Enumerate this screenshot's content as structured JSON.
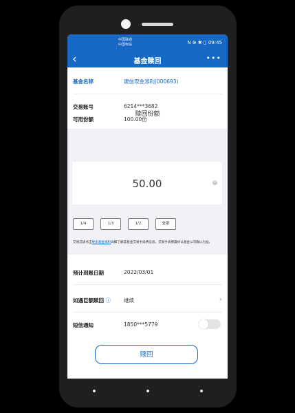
{
  "status_bar": {
    "carrier_line1": "中国联通",
    "carrier_line2": "中国电信",
    "indicators": "N ⊗ ✱ ▯",
    "time": "09:45"
  },
  "nav": {
    "back_icon": "chevron-left-icon",
    "title": "基金赎回",
    "more_icon": "more-dots-icon"
  },
  "fund": {
    "name_label": "基金名称",
    "name_value": "建信现金添利(000693)",
    "account_label": "交易账号",
    "account_value": "6214***3682",
    "available_label": "可用份额",
    "available_value": "100.00份"
  },
  "redeem": {
    "section_title": "赎回份额",
    "amount": "50.00",
    "fractions": [
      "1/4",
      "1/3",
      "1/2",
      "全部"
    ]
  },
  "notice": {
    "text_before": "交易前请点击",
    "link_text": "更多基金资料",
    "text_after": "详细了解该基金交易手续费信息。交易手续费最终以基金公司确认为准。"
  },
  "details": {
    "arrival_label": "预计到账日期",
    "arrival_value": "2022/03/01",
    "large_label": "如遇巨额赎回",
    "large_value": "继续",
    "sms_label": "短信通知",
    "sms_value": "1850***5779",
    "sms_enabled": false
  },
  "action": {
    "redeem_button": "赎回"
  },
  "colors": {
    "primary": "#1668c4",
    "background_gray": "#f1f2f5"
  }
}
